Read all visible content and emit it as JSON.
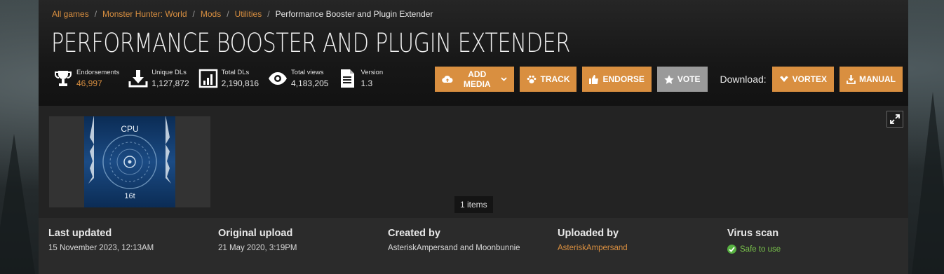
{
  "breadcrumb": {
    "items": [
      "All games",
      "Monster Hunter: World",
      "Mods",
      "Utilities"
    ],
    "current": "Performance Booster and Plugin Extender"
  },
  "mod": {
    "title": "PERFORMANCE BOOSTER AND PLUGIN EXTENDER"
  },
  "stats": {
    "endorsements": {
      "label": "Endorsements",
      "value": "46,997",
      "icon": "trophy-icon"
    },
    "unique_dls": {
      "label": "Unique DLs",
      "value": "1,127,872",
      "icon": "download-icon"
    },
    "total_dls": {
      "label": "Total DLs",
      "value": "2,190,816",
      "icon": "bar-chart-icon"
    },
    "total_views": {
      "label": "Total views",
      "value": "4,183,205",
      "icon": "eye-icon"
    },
    "version": {
      "label": "Version",
      "value": "1.3",
      "icon": "document-icon"
    }
  },
  "actions": {
    "add_media": "ADD MEDIA",
    "track": "TRACK",
    "endorse": "ENDORSE",
    "vote": "VOTE",
    "download_label": "Download:",
    "vortex": "VORTEX",
    "manual": "MANUAL"
  },
  "gallery": {
    "count": "1 items",
    "thumb_text_top": "CPU",
    "thumb_text_bottom": "16t"
  },
  "meta": {
    "last_updated": {
      "label": "Last updated",
      "value": "15 November 2023,  12:13AM"
    },
    "original_upload": {
      "label": "Original upload",
      "value": "21 May 2020,  3:19PM"
    },
    "created_by": {
      "label": "Created by",
      "value": "AsteriskAmpersand and Moonbunnie"
    },
    "uploaded_by": {
      "label": "Uploaded by",
      "value": "AsteriskAmpersand"
    },
    "virus_scan": {
      "label": "Virus scan",
      "value": "Safe to use"
    }
  },
  "colors": {
    "accent": "#d98f40",
    "vote": "#9a9a9a",
    "safe": "#57b241",
    "panel": "#232323"
  }
}
